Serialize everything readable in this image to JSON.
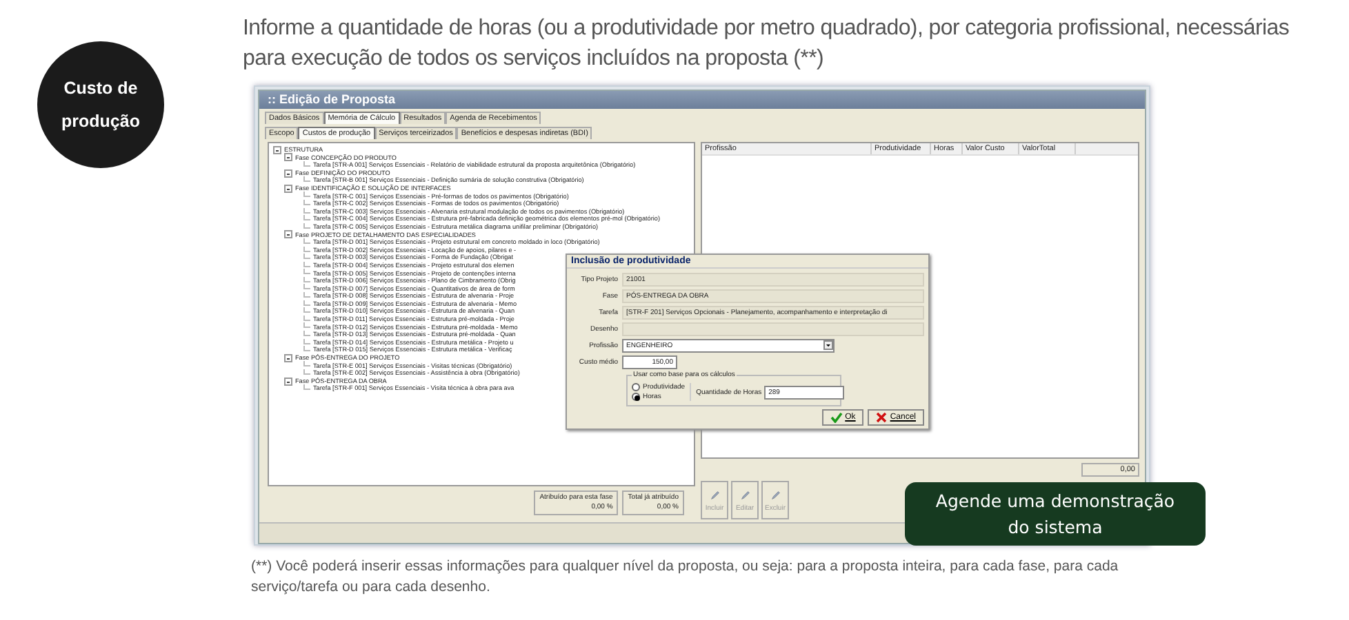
{
  "badge": {
    "lines": [
      "Custo de",
      "produção"
    ]
  },
  "heading": "Informe a quantidade de horas (ou a produtividade por metro quadrado), por categoria profissional, necessárias para execução de todos os serviços incluídos na proposta (**)",
  "window": {
    "title": ":: Edição de Proposta",
    "tabs": [
      {
        "label": "Dados Básicos",
        "selected": false
      },
      {
        "label": "Memória de Cálculo",
        "selected": true
      },
      {
        "label": "Resultados",
        "selected": false
      },
      {
        "label": "Agenda de Recebimentos",
        "selected": false
      }
    ],
    "subtabs": [
      {
        "label": "Escopo",
        "selected": false
      },
      {
        "label": "Custos de produção",
        "selected": true
      },
      {
        "label": "Serviços terceirizados",
        "selected": false
      },
      {
        "label": "Benefícios e despesas indiretas (BDI)",
        "selected": false
      }
    ],
    "tree": {
      "label": "ESTRUTURA",
      "expanded": true,
      "children": [
        {
          "label": "Fase CONCEPÇÃO DO PRODUTO",
          "expanded": true,
          "children": [
            {
              "label": "Tarefa [STR-A 001] Serviços Essenciais - Relatório de viabilidade estrutural da proposta arquitetônica (Obrigatório)"
            }
          ]
        },
        {
          "label": "Fase DEFINIÇÃO DO PRODUTO",
          "expanded": true,
          "children": [
            {
              "label": "Tarefa [STR-B 001] Serviços Essenciais - Definição sumária de solução construtiva (Obrigatório)"
            }
          ]
        },
        {
          "label": "Fase IDENTIFICAÇÃO E SOLUÇÃO DE INTERFACES",
          "expanded": true,
          "children": [
            {
              "label": "Tarefa [STR-C 001] Serviços Essenciais - Pré-formas de todos os pavimentos (Obrigatório)"
            },
            {
              "label": "Tarefa [STR-C 002] Serviços Essenciais - Formas de todos os pavimentos (Obrigatório)"
            },
            {
              "label": "Tarefa [STR-C 003] Serviços Essenciais - Alvenaria estrutural modulação de todos os pavimentos (Obrigatório)"
            },
            {
              "label": "Tarefa [STR-C 004] Serviços Essenciais - Estrutura pré-fabricada definição geométrica dos elementos pré-mol (Obrigatório)"
            },
            {
              "label": "Tarefa [STR-C 005] Serviços Essenciais - Estrutura metálica diagrama unifilar preliminar (Obrigatório)"
            }
          ]
        },
        {
          "label": "Fase PROJETO DE DETALHAMENTO DAS ESPECIALIDADES",
          "expanded": true,
          "children": [
            {
              "label": "Tarefa [STR-D 001] Serviços Essenciais - Projeto estrutural em concreto moldado in loco (Obrigatório)"
            },
            {
              "label": "Tarefa [STR-D 002] Serviços Essenciais - Locação de apoios, pilares e -"
            },
            {
              "label": "Tarefa [STR-D 003] Serviços Essenciais - Forma de Fundação (Obrigat"
            },
            {
              "label": "Tarefa [STR-D 004] Serviços Essenciais - Projeto estrutural dos elemen"
            },
            {
              "label": "Tarefa [STR-D 005] Serviços Essenciais - Projeto de contenções interna"
            },
            {
              "label": "Tarefa [STR-D 006] Serviços Essenciais - Plano de Cimbramento (Obrig"
            },
            {
              "label": "Tarefa [STR-D 007] Serviços Essenciais - Quantitativos de área de form"
            },
            {
              "label": "Tarefa [STR-D 008] Serviços Essenciais - Estrutura de alvenaria - Proje"
            },
            {
              "label": "Tarefa [STR-D 009] Serviços Essenciais - Estrutura de alvenaria - Memo"
            },
            {
              "label": "Tarefa [STR-D 010] Serviços Essenciais - Estrutura de alvenaria - Quan"
            },
            {
              "label": "Tarefa [STR-D 011] Serviços Essenciais - Estrutura pré-moldada - Proje"
            },
            {
              "label": "Tarefa [STR-D 012] Serviços Essenciais - Estrutura pré-moldada - Memo"
            },
            {
              "label": "Tarefa [STR-D 013] Serviços Essenciais - Estrutura pré-moldada - Quan"
            },
            {
              "label": "Tarefa [STR-D 014] Serviços Essenciais - Estrutura metálica - Projeto u"
            },
            {
              "label": "Tarefa [STR-D 015] Serviços Essenciais - Estrutura metálica - Verificaç"
            }
          ]
        },
        {
          "label": "Fase PÓS-ENTREGA DO PROJETO",
          "expanded": true,
          "children": [
            {
              "label": "Tarefa [STR-E 001] Serviços Essenciais - Visitas técnicas (Obrigatório)"
            },
            {
              "label": "Tarefa [STR-E 002] Serviços Essenciais - Assistência à obra (Obrigatório)"
            }
          ]
        },
        {
          "label": "Fase PÓS-ENTREGA DA OBRA",
          "expanded": true,
          "children": [
            {
              "label": "Tarefa [STR-F 001] Serviços Essenciais - Visita técnica à obra para ava"
            }
          ]
        }
      ]
    },
    "attribution": [
      {
        "label": "Atribuído para esta fase",
        "value": "0,00 %"
      },
      {
        "label": "Total já atribuído",
        "value": "0,00 %"
      }
    ],
    "table": {
      "columns": [
        "Profissão",
        "Produtividade",
        "Horas",
        "Valor Custo",
        "ValorTotal"
      ],
      "total": "0,00"
    },
    "actions": [
      {
        "label": "Incluir",
        "disabled": true
      },
      {
        "label": "Editar",
        "disabled": true
      },
      {
        "label": "Excluir",
        "disabled": true
      }
    ],
    "dialog": {
      "title": "Inclusão de produtividade",
      "fields": [
        {
          "label": "Tipo Projeto",
          "value": "21001"
        },
        {
          "label": "Fase",
          "value": "PÓS-ENTREGA DA OBRA"
        },
        {
          "label": "Tarefa",
          "value": "[STR-F 201] Serviços Opcionais - Planejamento, acompanhamento e interpretação di"
        },
        {
          "label": "Desenho"
        }
      ],
      "profession": {
        "label": "Profissão",
        "value": "ENGENHEIRO"
      },
      "cost": {
        "label": "Custo médio",
        "value": "150,00"
      },
      "basis": {
        "title": "Usar como base para os cálculos",
        "options": [
          {
            "label": "Produtividade",
            "selected": false
          },
          {
            "label": "Horas",
            "selected": true
          }
        ],
        "hours_label": "Quantidade de Horas",
        "hours_value": "289"
      },
      "buttons": [
        {
          "label": "Ok",
          "kind": "ok"
        },
        {
          "label": "Cancel",
          "kind": "cancel"
        }
      ]
    }
  },
  "footnote": "(**) Você poderá inserir essas informações para qualquer nível da proposta, ou seja: para a proposta inteira, para cada fase, para cada serviço/tarefa ou para cada desenho.",
  "cta": {
    "lines": [
      "Agende uma demonstração",
      "do sistema"
    ]
  }
}
